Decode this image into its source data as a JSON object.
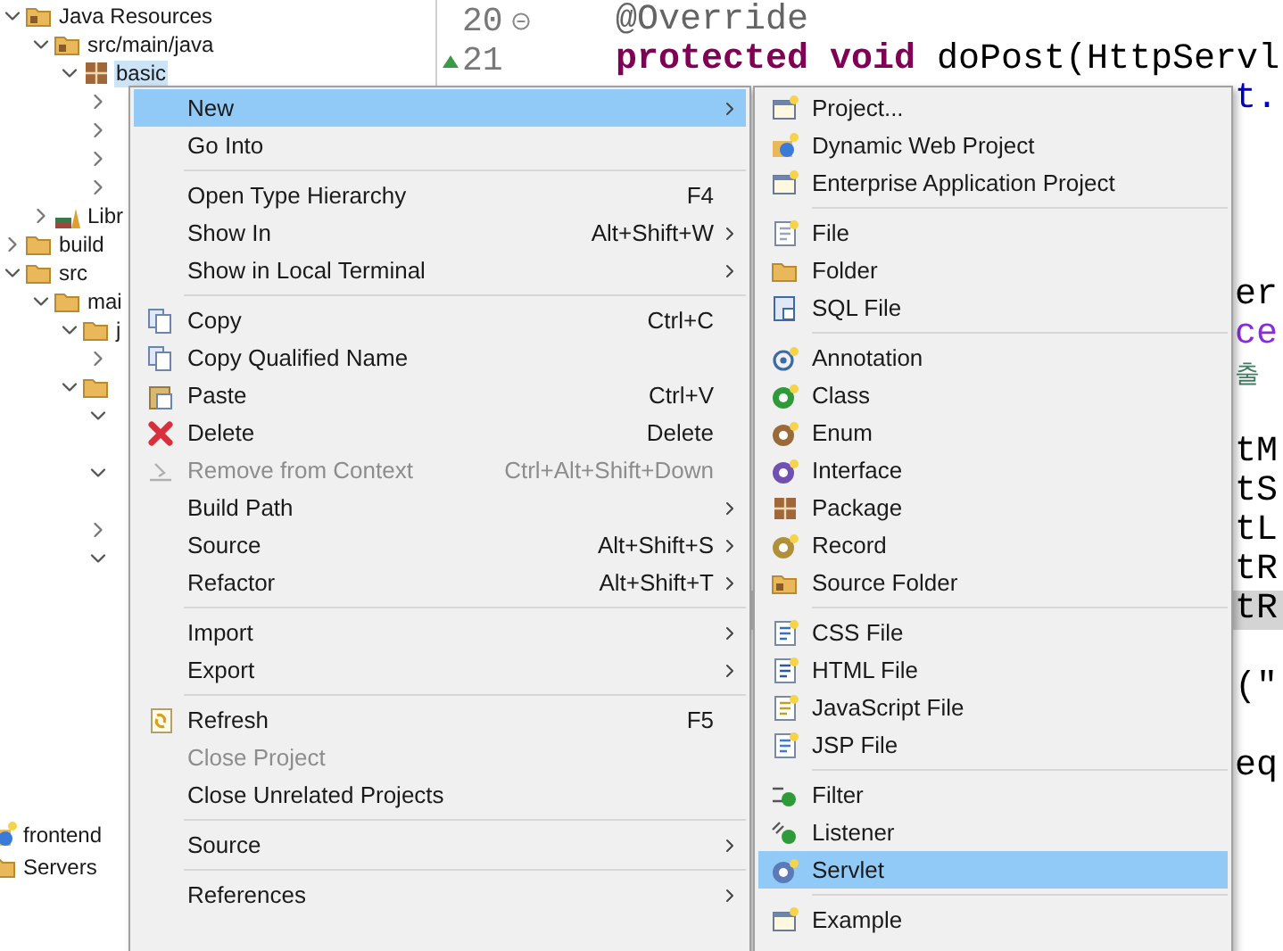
{
  "tree": {
    "items": [
      {
        "label": "Java Resources",
        "kind": "srcfolder",
        "expanded": true,
        "selected": false,
        "children": [
          {
            "label": "src/main/java",
            "kind": "package-root",
            "expanded": true,
            "selected": false,
            "children": [
              {
                "label": "basic",
                "kind": "package",
                "expanded": true,
                "selected": true,
                "children": [
                  {
                    "expanded": false
                  },
                  {
                    "expanded": false
                  },
                  {
                    "expanded": false
                  },
                  {
                    "expanded": false
                  }
                ]
              }
            ]
          },
          {
            "label": "Libr",
            "kind": "library",
            "expanded": false,
            "selected": false
          }
        ]
      },
      {
        "label": "build",
        "kind": "folder",
        "expanded": false,
        "selected": false
      },
      {
        "label": "src",
        "kind": "folder",
        "expanded": true,
        "selected": false,
        "children": [
          {
            "label": "mai",
            "kind": "folder",
            "expanded": true,
            "selected": false,
            "children": [
              {
                "label": "j",
                "kind": "folder",
                "expanded": true,
                "selected": false,
                "children": [
                  {
                    "expanded": false
                  }
                ]
              },
              {
                "kind": "folder",
                "expanded": true,
                "children": [
                  {
                    "expanded": true
                  },
                  {
                    "expanded": true
                  },
                  {
                    "expanded": false
                  },
                  {
                    "expanded": true
                  }
                ]
              }
            ]
          }
        ]
      }
    ]
  },
  "projects": [
    {
      "label": "frontend",
      "kind": "webproject"
    },
    {
      "label": "Servers",
      "kind": "folder"
    }
  ],
  "editor": {
    "lines": [
      {
        "kind": "full",
        "number": "20",
        "highlighted": false,
        "parts": [
          {
            "text": "@Override",
            "kind": "annotation"
          }
        ]
      },
      {
        "kind": "full",
        "number": "21",
        "highlighted": false,
        "parts": [
          {
            "text": "protected void",
            "kind": "keyword"
          },
          {
            "text": " doPost(HttpServl",
            "kind": "plain"
          }
        ]
      },
      {
        "kind": "partial",
        "highlighted": false,
        "parts": [
          {
            "text": "t.",
            "kind": "field"
          }
        ]
      },
      {
        "kind": "blank",
        "highlighted": false
      },
      {
        "kind": "blank",
        "highlighted": false
      },
      {
        "kind": "blank",
        "highlighted": false
      },
      {
        "kind": "blank",
        "highlighted": false
      },
      {
        "kind": "partial",
        "highlighted": false,
        "parts": [
          {
            "text": "er",
            "kind": "plain"
          }
        ]
      },
      {
        "kind": "partial",
        "highlighted": false,
        "parts": [
          {
            "text": "ce",
            "kind": "local"
          }
        ]
      },
      {
        "kind": "partial",
        "highlighted": false,
        "parts": [
          {
            "text": "출",
            "kind": "comment"
          }
        ]
      },
      {
        "kind": "blank",
        "highlighted": false
      },
      {
        "kind": "partial",
        "highlighted": false,
        "parts": [
          {
            "text": "tM",
            "kind": "plain"
          }
        ]
      },
      {
        "kind": "partial",
        "highlighted": false,
        "parts": [
          {
            "text": "tS",
            "kind": "plain"
          }
        ]
      },
      {
        "kind": "partial",
        "highlighted": false,
        "parts": [
          {
            "text": "tL",
            "kind": "plain"
          }
        ]
      },
      {
        "kind": "partial",
        "highlighted": false,
        "parts": [
          {
            "text": "tR",
            "kind": "plain"
          }
        ]
      },
      {
        "kind": "partial",
        "highlighted": true,
        "parts": [
          {
            "text": "tR",
            "kind": "plain"
          }
        ]
      },
      {
        "kind": "blank",
        "highlighted": false
      },
      {
        "kind": "partial",
        "highlighted": false,
        "parts": [
          {
            "text": "(\"",
            "kind": "plain"
          }
        ]
      },
      {
        "kind": "blank",
        "highlighted": false
      },
      {
        "kind": "partial",
        "highlighted": false,
        "parts": [
          {
            "text": "eq",
            "kind": "plain"
          }
        ]
      }
    ]
  },
  "context_menu": {
    "items": [
      {
        "kind": "plain",
        "label": "New",
        "selected": true,
        "disabled": false,
        "submenu": true
      },
      {
        "kind": "plain",
        "label": "Go Into",
        "selected": false,
        "disabled": false,
        "submenu": false
      },
      {
        "kind": "separator"
      },
      {
        "kind": "plain",
        "label": "Open Type Hierarchy",
        "shortcut": "F4",
        "selected": false,
        "disabled": false,
        "submenu": false
      },
      {
        "kind": "plain",
        "label": "Show In",
        "shortcut": "Alt+Shift+W",
        "selected": false,
        "disabled": false,
        "submenu": true
      },
      {
        "kind": "plain",
        "label": "Show in Local Terminal",
        "selected": false,
        "disabled": false,
        "submenu": true
      },
      {
        "kind": "separator"
      },
      {
        "kind": "copy",
        "label": "Copy",
        "shortcut": "Ctrl+C",
        "selected": false,
        "disabled": false,
        "submenu": false
      },
      {
        "kind": "copyname",
        "label": "Copy Qualified Name",
        "selected": false,
        "disabled": false,
        "submenu": false
      },
      {
        "kind": "paste",
        "label": "Paste",
        "shortcut": "Ctrl+V",
        "selected": false,
        "disabled": false,
        "submenu": false
      },
      {
        "kind": "delete",
        "label": "Delete",
        "shortcut": "Delete",
        "selected": false,
        "disabled": false,
        "submenu": false
      },
      {
        "kind": "remove",
        "label": "Remove from Context",
        "shortcut": "Ctrl+Alt+Shift+Down",
        "selected": false,
        "disabled": true,
        "submenu": false
      },
      {
        "kind": "plain",
        "label": "Build Path",
        "selected": false,
        "disabled": false,
        "submenu": true
      },
      {
        "kind": "plain",
        "label": "Source",
        "shortcut": "Alt+Shift+S",
        "selected": false,
        "disabled": false,
        "submenu": true
      },
      {
        "kind": "plain",
        "label": "Refactor",
        "shortcut": "Alt+Shift+T",
        "selected": false,
        "disabled": false,
        "submenu": true
      },
      {
        "kind": "separator"
      },
      {
        "kind": "plain",
        "label": "Import",
        "selected": false,
        "disabled": false,
        "submenu": true
      },
      {
        "kind": "plain",
        "label": "Export",
        "selected": false,
        "disabled": false,
        "submenu": true
      },
      {
        "kind": "separator"
      },
      {
        "kind": "refresh",
        "label": "Refresh",
        "shortcut": "F5",
        "selected": false,
        "disabled": false,
        "submenu": false
      },
      {
        "kind": "plain",
        "label": "Close Project",
        "selected": false,
        "disabled": true,
        "submenu": false
      },
      {
        "kind": "plain",
        "label": "Close Unrelated Projects",
        "selected": false,
        "disabled": false,
        "submenu": false
      },
      {
        "kind": "separator"
      },
      {
        "kind": "plain",
        "label": "Source",
        "selected": false,
        "disabled": false,
        "submenu": true
      },
      {
        "kind": "separator"
      },
      {
        "kind": "plain",
        "label": "References",
        "selected": false,
        "disabled": false,
        "submenu": true
      }
    ]
  },
  "new_submenu": {
    "items": [
      {
        "kind": "project",
        "label": "Project...",
        "selected": false
      },
      {
        "kind": "webproject",
        "label": "Dynamic Web Project",
        "selected": false
      },
      {
        "kind": "earproject",
        "label": "Enterprise Application Project",
        "selected": false
      },
      {
        "kind": "separator"
      },
      {
        "kind": "file",
        "label": "File",
        "selected": false
      },
      {
        "kind": "folder",
        "label": "Folder",
        "selected": false
      },
      {
        "kind": "sql",
        "label": "SQL File",
        "selected": false
      },
      {
        "kind": "separator"
      },
      {
        "kind": "annotation",
        "label": "Annotation",
        "selected": false
      },
      {
        "kind": "class",
        "label": "Class",
        "selected": false
      },
      {
        "kind": "enum",
        "label": "Enum",
        "selected": false
      },
      {
        "kind": "interface",
        "label": "Interface",
        "selected": false
      },
      {
        "kind": "package",
        "label": "Package",
        "selected": false
      },
      {
        "kind": "record",
        "label": "Record",
        "selected": false
      },
      {
        "kind": "srcfolder",
        "label": "Source Folder",
        "selected": false
      },
      {
        "kind": "separator"
      },
      {
        "kind": "css",
        "label": "CSS File",
        "selected": false
      },
      {
        "kind": "html",
        "label": "HTML File",
        "selected": false
      },
      {
        "kind": "js",
        "label": "JavaScript File",
        "selected": false
      },
      {
        "kind": "jsp",
        "label": "JSP File",
        "selected": false
      },
      {
        "kind": "separator"
      },
      {
        "kind": "filter",
        "label": "Filter",
        "selected": false
      },
      {
        "kind": "listener",
        "label": "Listener",
        "selected": false
      },
      {
        "kind": "servlet",
        "label": "Servlet",
        "selected": true
      },
      {
        "kind": "separator"
      },
      {
        "kind": "example",
        "label": "Example",
        "selected": false
      }
    ]
  }
}
